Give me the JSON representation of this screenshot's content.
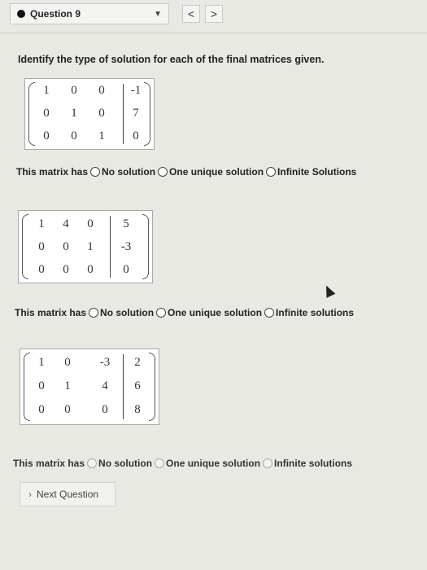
{
  "header": {
    "question_label": "Question 9",
    "prev_label": "<",
    "next_label": ">"
  },
  "prompt": "Identify the type of solution for each of the final matrices given.",
  "matrices": [
    {
      "rows": [
        [
          "1",
          "0",
          "0",
          "-1"
        ],
        [
          "0",
          "1",
          "0",
          "7"
        ],
        [
          "0",
          "0",
          "1",
          "0"
        ]
      ]
    },
    {
      "rows": [
        [
          "1",
          "4",
          "0",
          "5"
        ],
        [
          "0",
          "0",
          "1",
          "-3"
        ],
        [
          "0",
          "0",
          "0",
          "0"
        ]
      ]
    },
    {
      "rows": [
        [
          "1",
          "0",
          "-3",
          "2"
        ],
        [
          "0",
          "1",
          "4",
          "6"
        ],
        [
          "0",
          "0",
          "0",
          "8"
        ]
      ]
    }
  ],
  "questions": [
    {
      "lead": "This matrix has",
      "options": [
        "No solution",
        "One unique solution",
        "Infinite Solutions"
      ]
    },
    {
      "lead": "This matrix has",
      "options": [
        "No solution",
        "One unique solution",
        "Infinite solutions"
      ]
    },
    {
      "lead": "This matrix has",
      "options": [
        "No solution",
        "One unique solution",
        "Infinite solutions"
      ]
    }
  ],
  "next_question_label": "Next Question",
  "colors": {
    "background": "#e9e9e4",
    "panel": "#ffffff",
    "text": "#222222"
  }
}
